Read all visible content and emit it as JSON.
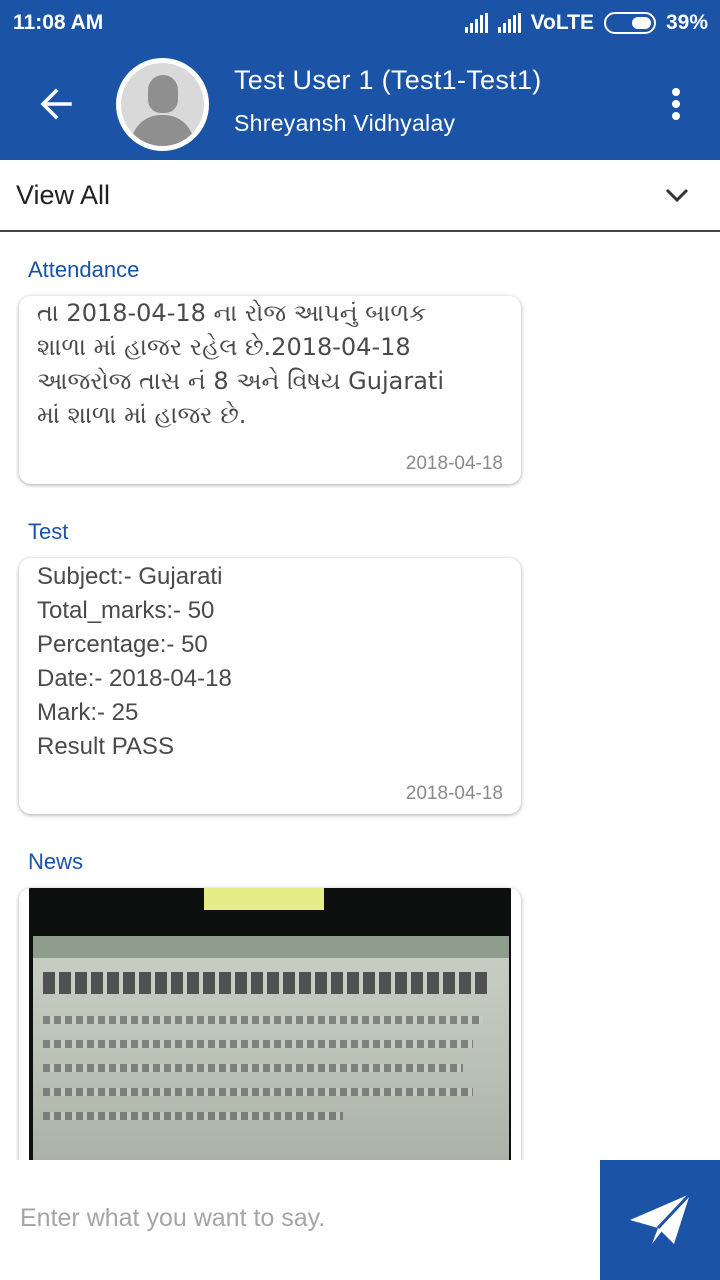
{
  "status_bar": {
    "time": "11:08 AM",
    "network": "VoLTE",
    "battery": "39%",
    "battery_level": 0.39
  },
  "header": {
    "user_name": "Test User 1 (Test1-Test1)",
    "school_name": "Shreyansh Vidhyalay",
    "back_icon": "arrow-left-icon",
    "menu_icon": "more-vertical-icon",
    "color": "#1b53a6"
  },
  "filter": {
    "label": "View All",
    "icon": "chevron-down-icon"
  },
  "feed": {
    "attendance": {
      "title": "Attendance",
      "lines": [
        "તા 2018-04-18 ના રોજ આપનું બાળક",
        "શાળા માં હાજર રહેલ છે.2018-04-18",
        "આજરોજ તાસ નં 8 અને વિષય Gujarati",
        "માં શાળા માં હાજર છે."
      ],
      "date": "2018-04-18"
    },
    "test": {
      "title": "Test",
      "lines": [
        "Subject:- Gujarati",
        "Total_marks:- 50",
        "Percentage:- 50",
        "Date:- 2018-04-18",
        "Mark:- 25",
        "Result PASS"
      ],
      "date": "2018-04-18"
    },
    "news": {
      "title": "News",
      "image": "newspaper-clipping-photo"
    }
  },
  "composer": {
    "placeholder": "Enter what you want to say.",
    "send_icon": "send-icon"
  }
}
